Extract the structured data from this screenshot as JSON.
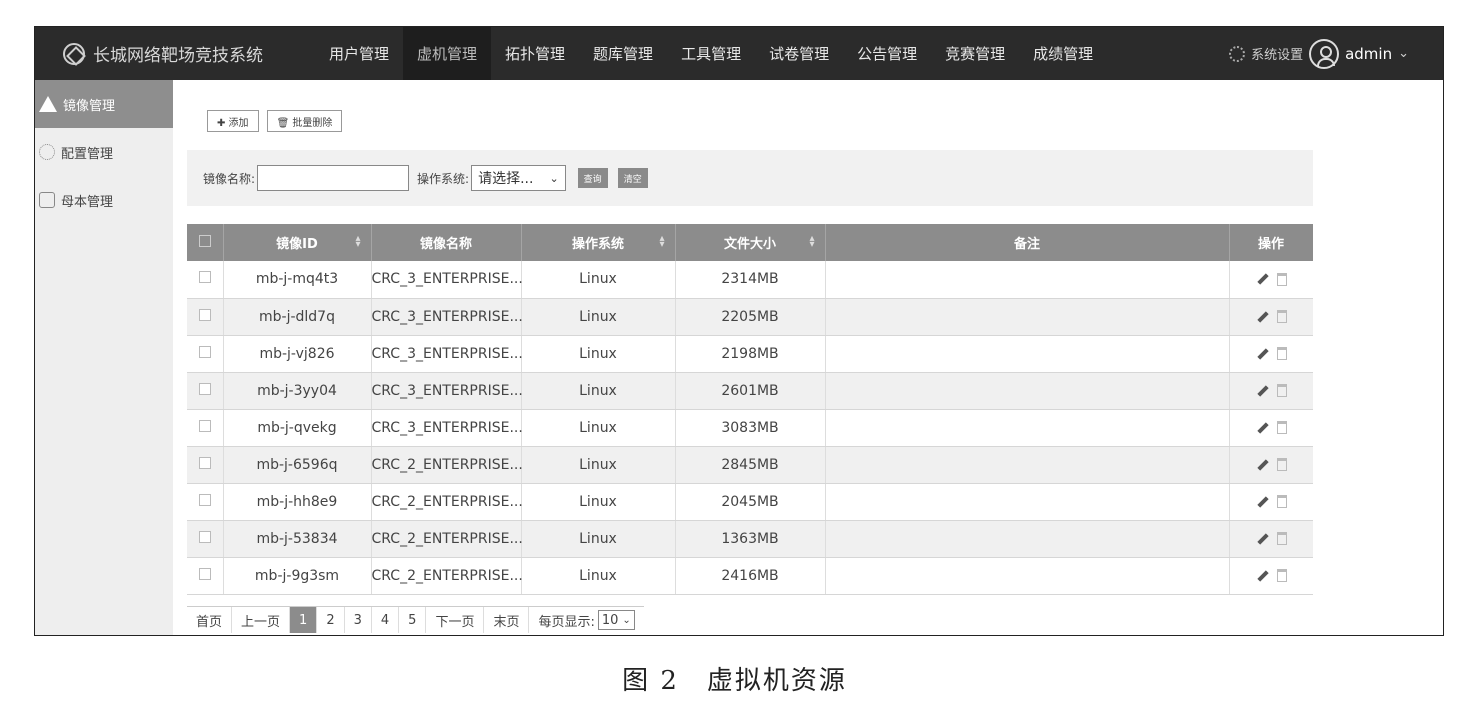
{
  "header": {
    "app_title": "长城网络靶场竞技系统",
    "nav": [
      "用户管理",
      "虚机管理",
      "拓扑管理",
      "题库管理",
      "工具管理",
      "试卷管理",
      "公告管理",
      "竞赛管理",
      "成绩管理"
    ],
    "active_nav": "虚机管理",
    "settings_label": "系统设置",
    "user": "admin"
  },
  "sidebar": {
    "items": [
      {
        "label": "镜像管理",
        "icon": "warning-triangle-icon",
        "active": true
      },
      {
        "label": "配置管理",
        "icon": "gear-icon",
        "active": false
      },
      {
        "label": "母本管理",
        "icon": "template-icon",
        "active": false
      }
    ]
  },
  "toolbar": {
    "add_label": "✚ 添加",
    "batch_delete_label": "🗑 批量删除"
  },
  "filter": {
    "name_label": "镜像名称:",
    "os_label": "操作系统:",
    "os_selected": "请选择...",
    "query_label": "查询",
    "clear_label": "清空"
  },
  "table": {
    "columns": [
      "镜像ID",
      "镜像名称",
      "操作系统",
      "文件大小",
      "备注",
      "操作"
    ],
    "rows": [
      {
        "id": "mb-j-mq4t3",
        "name": "CRC_3_ENTERPRISE...",
        "os": "Linux",
        "size": "2314MB",
        "note": ""
      },
      {
        "id": "mb-j-dld7q",
        "name": "CRC_3_ENTERPRISE...",
        "os": "Linux",
        "size": "2205MB",
        "note": ""
      },
      {
        "id": "mb-j-vj826",
        "name": "CRC_3_ENTERPRISE...",
        "os": "Linux",
        "size": "2198MB",
        "note": ""
      },
      {
        "id": "mb-j-3yy04",
        "name": "CRC_3_ENTERPRISE...",
        "os": "Linux",
        "size": "2601MB",
        "note": ""
      },
      {
        "id": "mb-j-qvekg",
        "name": "CRC_3_ENTERPRISE...",
        "os": "Linux",
        "size": "3083MB",
        "note": ""
      },
      {
        "id": "mb-j-6596q",
        "name": "CRC_2_ENTERPRISE...",
        "os": "Linux",
        "size": "2845MB",
        "note": ""
      },
      {
        "id": "mb-j-hh8e9",
        "name": "CRC_2_ENTERPRISE...",
        "os": "Linux",
        "size": "2045MB",
        "note": ""
      },
      {
        "id": "mb-j-53834",
        "name": "CRC_2_ENTERPRISE...",
        "os": "Linux",
        "size": "1363MB",
        "note": ""
      },
      {
        "id": "mb-j-9g3sm",
        "name": "CRC_2_ENTERPRISE...",
        "os": "Linux",
        "size": "2416MB",
        "note": ""
      }
    ]
  },
  "pager": {
    "first": "首页",
    "prev": "上一页",
    "pages": [
      "1",
      "2",
      "3",
      "4",
      "5"
    ],
    "current": "1",
    "next": "下一页",
    "last": "末页",
    "page_size_label": "每页显示:",
    "page_size": "10"
  },
  "caption": "图 2　虚拟机资源"
}
